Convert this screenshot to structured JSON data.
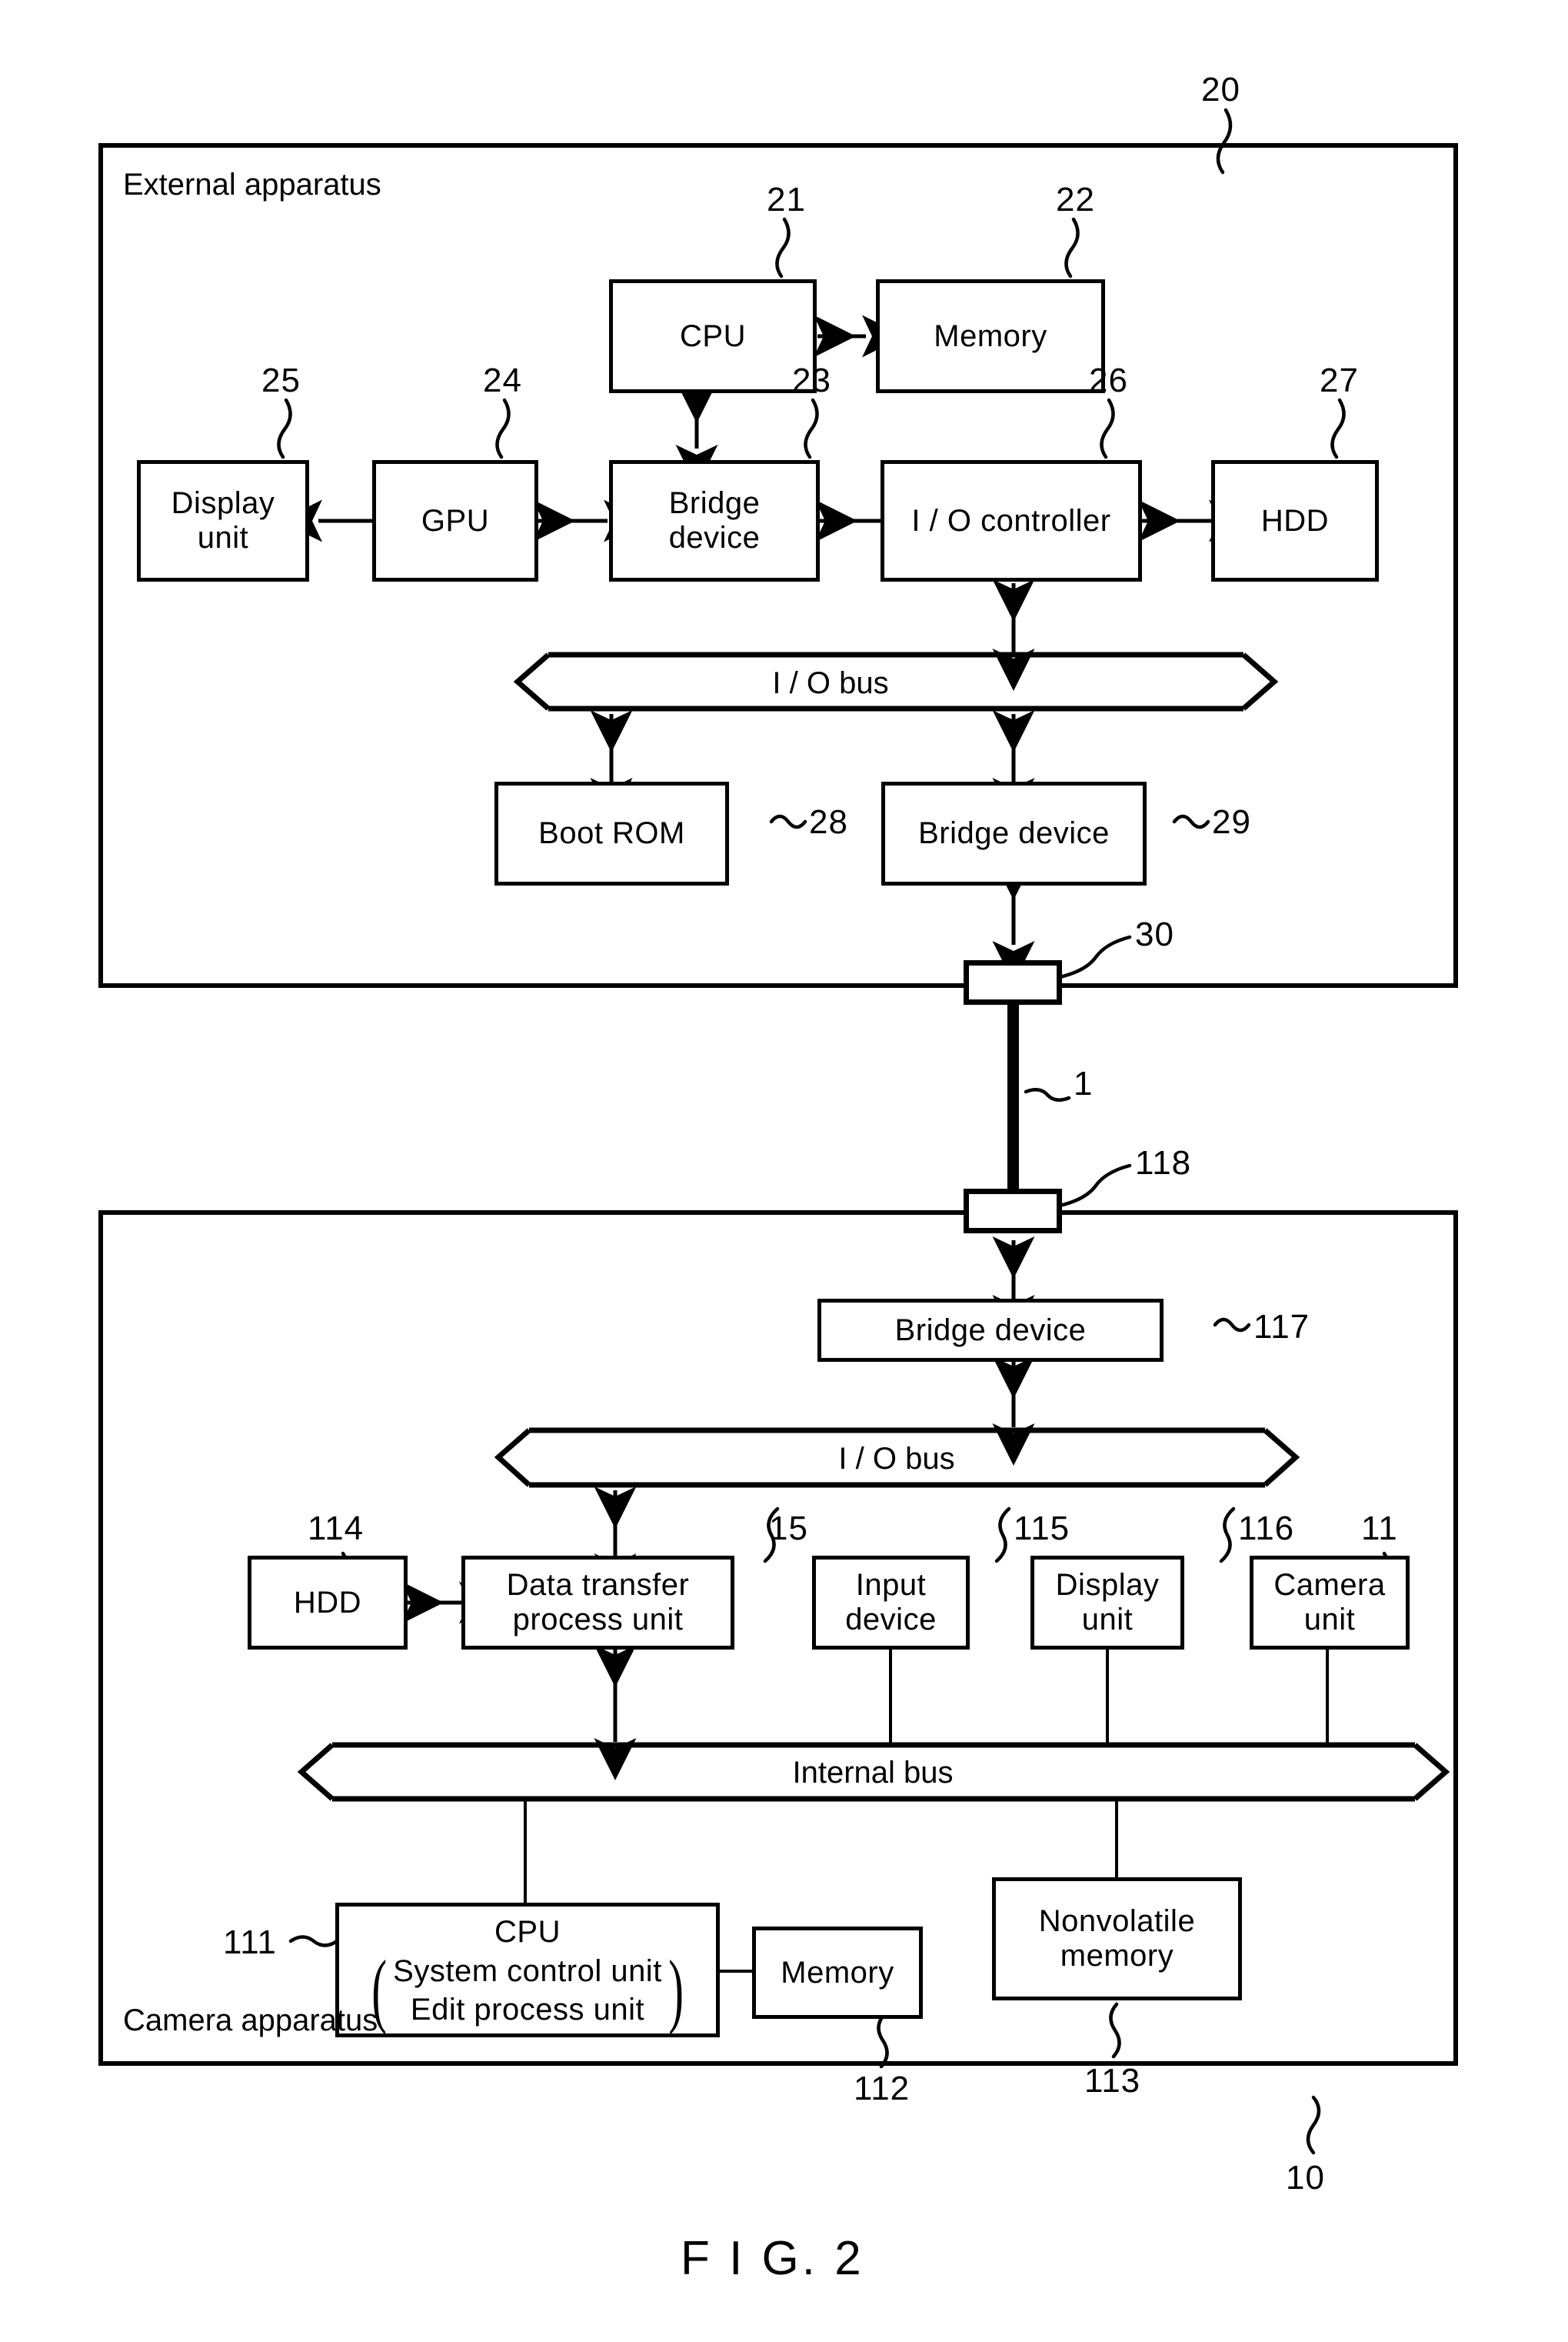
{
  "figure": {
    "caption": "F I G. 2"
  },
  "external_apparatus": {
    "label": "External apparatus",
    "ref": "20",
    "blocks": {
      "cpu": {
        "label": "CPU",
        "ref": "21"
      },
      "memory": {
        "label": "Memory",
        "ref": "22"
      },
      "bridge_device": {
        "label": "Bridge\ndevice",
        "line1": "Bridge",
        "line2": "device",
        "ref": "23"
      },
      "gpu": {
        "label": "GPU",
        "ref": "24"
      },
      "display_unit": {
        "line1": "Display",
        "line2": "unit",
        "ref": "25"
      },
      "io_controller": {
        "label": "I / O controller",
        "ref": "26"
      },
      "hdd": {
        "label": "HDD",
        "ref": "27"
      },
      "boot_rom": {
        "label": "Boot ROM",
        "ref": "28"
      },
      "bridge_device_2": {
        "label": "Bridge device",
        "ref": "29"
      },
      "io_bus": {
        "label": "I / O bus"
      },
      "connector": {
        "ref": "30"
      }
    }
  },
  "cable": {
    "ref": "1"
  },
  "camera_apparatus": {
    "label": "Camera apparatus",
    "ref": "10",
    "blocks": {
      "connector": {
        "ref": "118"
      },
      "bridge_device": {
        "label": "Bridge device",
        "ref": "117"
      },
      "io_bus": {
        "label": "I / O bus"
      },
      "hdd": {
        "label": "HDD",
        "ref": "114"
      },
      "data_transfer": {
        "line1": "Data transfer",
        "line2": "process unit",
        "ref": "15"
      },
      "input_device": {
        "line1": "Input",
        "line2": "device",
        "ref": "115"
      },
      "display_unit": {
        "line1": "Display",
        "line2": "unit",
        "ref": "116"
      },
      "camera_unit": {
        "line1": "Camera",
        "line2": "unit",
        "ref": "11"
      },
      "internal_bus": {
        "label": "Internal bus"
      },
      "cpu": {
        "title": "CPU",
        "sub1": "System control unit",
        "sub2": "Edit process unit",
        "ref": "111"
      },
      "memory": {
        "label": "Memory",
        "ref": "112"
      },
      "nonvolatile_memory": {
        "line1": "Nonvolatile",
        "line2": "memory",
        "ref": "113"
      }
    }
  },
  "colors": {
    "ink": "#000000",
    "paper": "#ffffff"
  }
}
